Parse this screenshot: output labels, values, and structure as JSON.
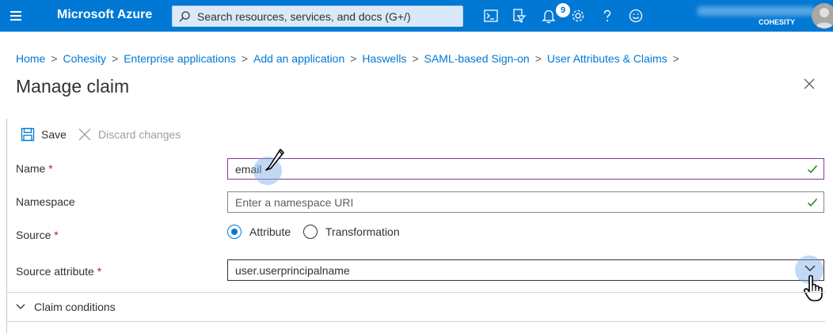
{
  "topbar": {
    "brand": "Microsoft Azure",
    "search_placeholder": "Search resources, services, and docs (G+/)",
    "notification_count": "9",
    "tenant": "COHESITY",
    "icons": [
      "hamburger-icon",
      "search-icon",
      "cloud-shell-icon",
      "directory-filter-icon",
      "notification-bell-icon",
      "settings-gear-icon",
      "help-icon",
      "feedback-smiley-icon",
      "avatar-icon"
    ],
    "accent_color": "#0078d4"
  },
  "breadcrumb": {
    "items": [
      "Home",
      "Cohesity",
      "Enterprise applications",
      "Add an application",
      "Haswells",
      "SAML-based Sign-on",
      "User Attributes & Claims"
    ],
    "separator": ">"
  },
  "page": {
    "title": "Manage claim"
  },
  "toolbar": {
    "save_label": "Save",
    "discard_label": "Discard changes"
  },
  "form": {
    "name": {
      "label": "Name",
      "required_mark": "*",
      "value": "email"
    },
    "namespace": {
      "label": "Namespace",
      "placeholder": "Enter a namespace URI",
      "value": ""
    },
    "source": {
      "label": "Source",
      "required_mark": "*",
      "options": [
        "Attribute",
        "Transformation"
      ],
      "selected": "Attribute"
    },
    "source_attribute": {
      "label": "Source attribute",
      "required_mark": "*",
      "value": "user.userprincipalname"
    },
    "claim_conditions_label": "Claim conditions"
  },
  "colors": {
    "focus_border": "#7d3c98",
    "valid_check": "#107c10",
    "required": "#a4262c",
    "link": "#0078d4"
  }
}
